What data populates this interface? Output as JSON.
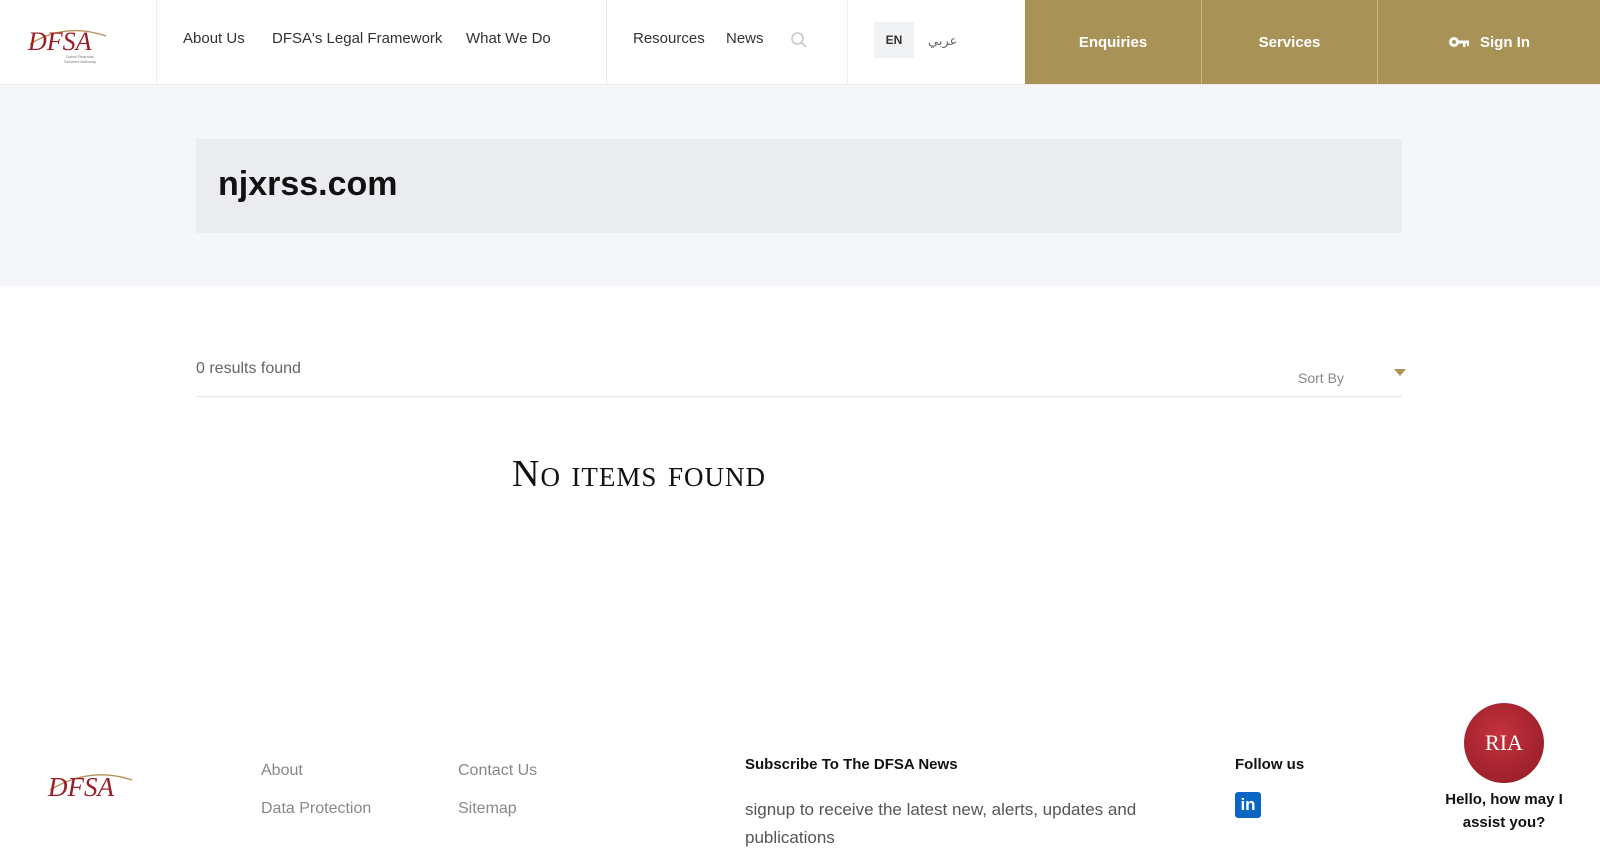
{
  "header": {
    "nav_left": [
      "About Us",
      "DFSA's Legal Framework",
      "What We Do"
    ],
    "nav_right": [
      "Resources",
      "News"
    ],
    "lang_en": "EN",
    "lang_ar": "عربي",
    "buttons": {
      "enquiries": "Enquiries",
      "services": "Services",
      "sign_in": "Sign In"
    }
  },
  "search": {
    "term": "njxrss.com"
  },
  "results": {
    "count_text": "0 results found",
    "sort_label": "Sort By",
    "empty_text": "No items found"
  },
  "footer": {
    "col1": [
      "About",
      "Data Protection"
    ],
    "col2": [
      "Contact Us",
      "Sitemap"
    ],
    "subscribe_heading": "Subscribe To The DFSA News",
    "subscribe_text": "signup to receive the latest new, alerts, updates and publications",
    "follow_heading": "Follow us",
    "linkedin_text": "in"
  },
  "chat": {
    "badge": "RIA",
    "greeting": "Hello, how may I assist you?"
  },
  "colors": {
    "gold": "#a99256",
    "brand_red": "#9c1c26"
  }
}
